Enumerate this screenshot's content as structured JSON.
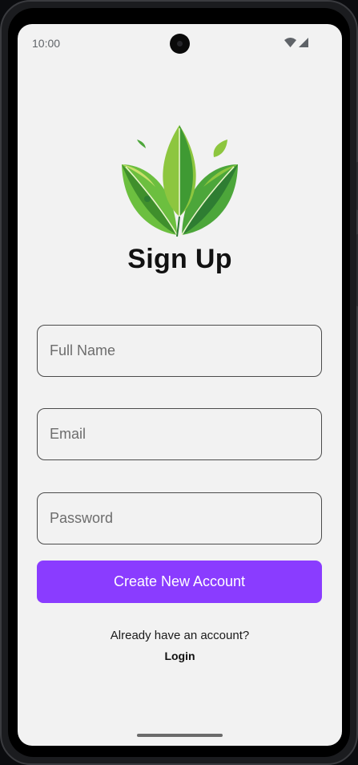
{
  "status_bar": {
    "time": "10:00",
    "icons": [
      "wifi-icon",
      "cellular-signal-icon"
    ]
  },
  "logo": {
    "icon": "leaf-logo-icon",
    "colors": [
      "#8dc63f",
      "#4caf3a",
      "#2e7d32",
      "#c8e06a"
    ]
  },
  "page": {
    "title": "Sign Up"
  },
  "form": {
    "full_name": {
      "placeholder": "Full Name",
      "value": ""
    },
    "email": {
      "placeholder": "Email",
      "value": ""
    },
    "password": {
      "placeholder": "Password",
      "value": ""
    },
    "submit_label": "Create New Account"
  },
  "footer": {
    "prompt": "Already have an account?",
    "login_label": "Login"
  },
  "colors": {
    "accent": "#8a3cff",
    "background": "#f2f2f2"
  }
}
